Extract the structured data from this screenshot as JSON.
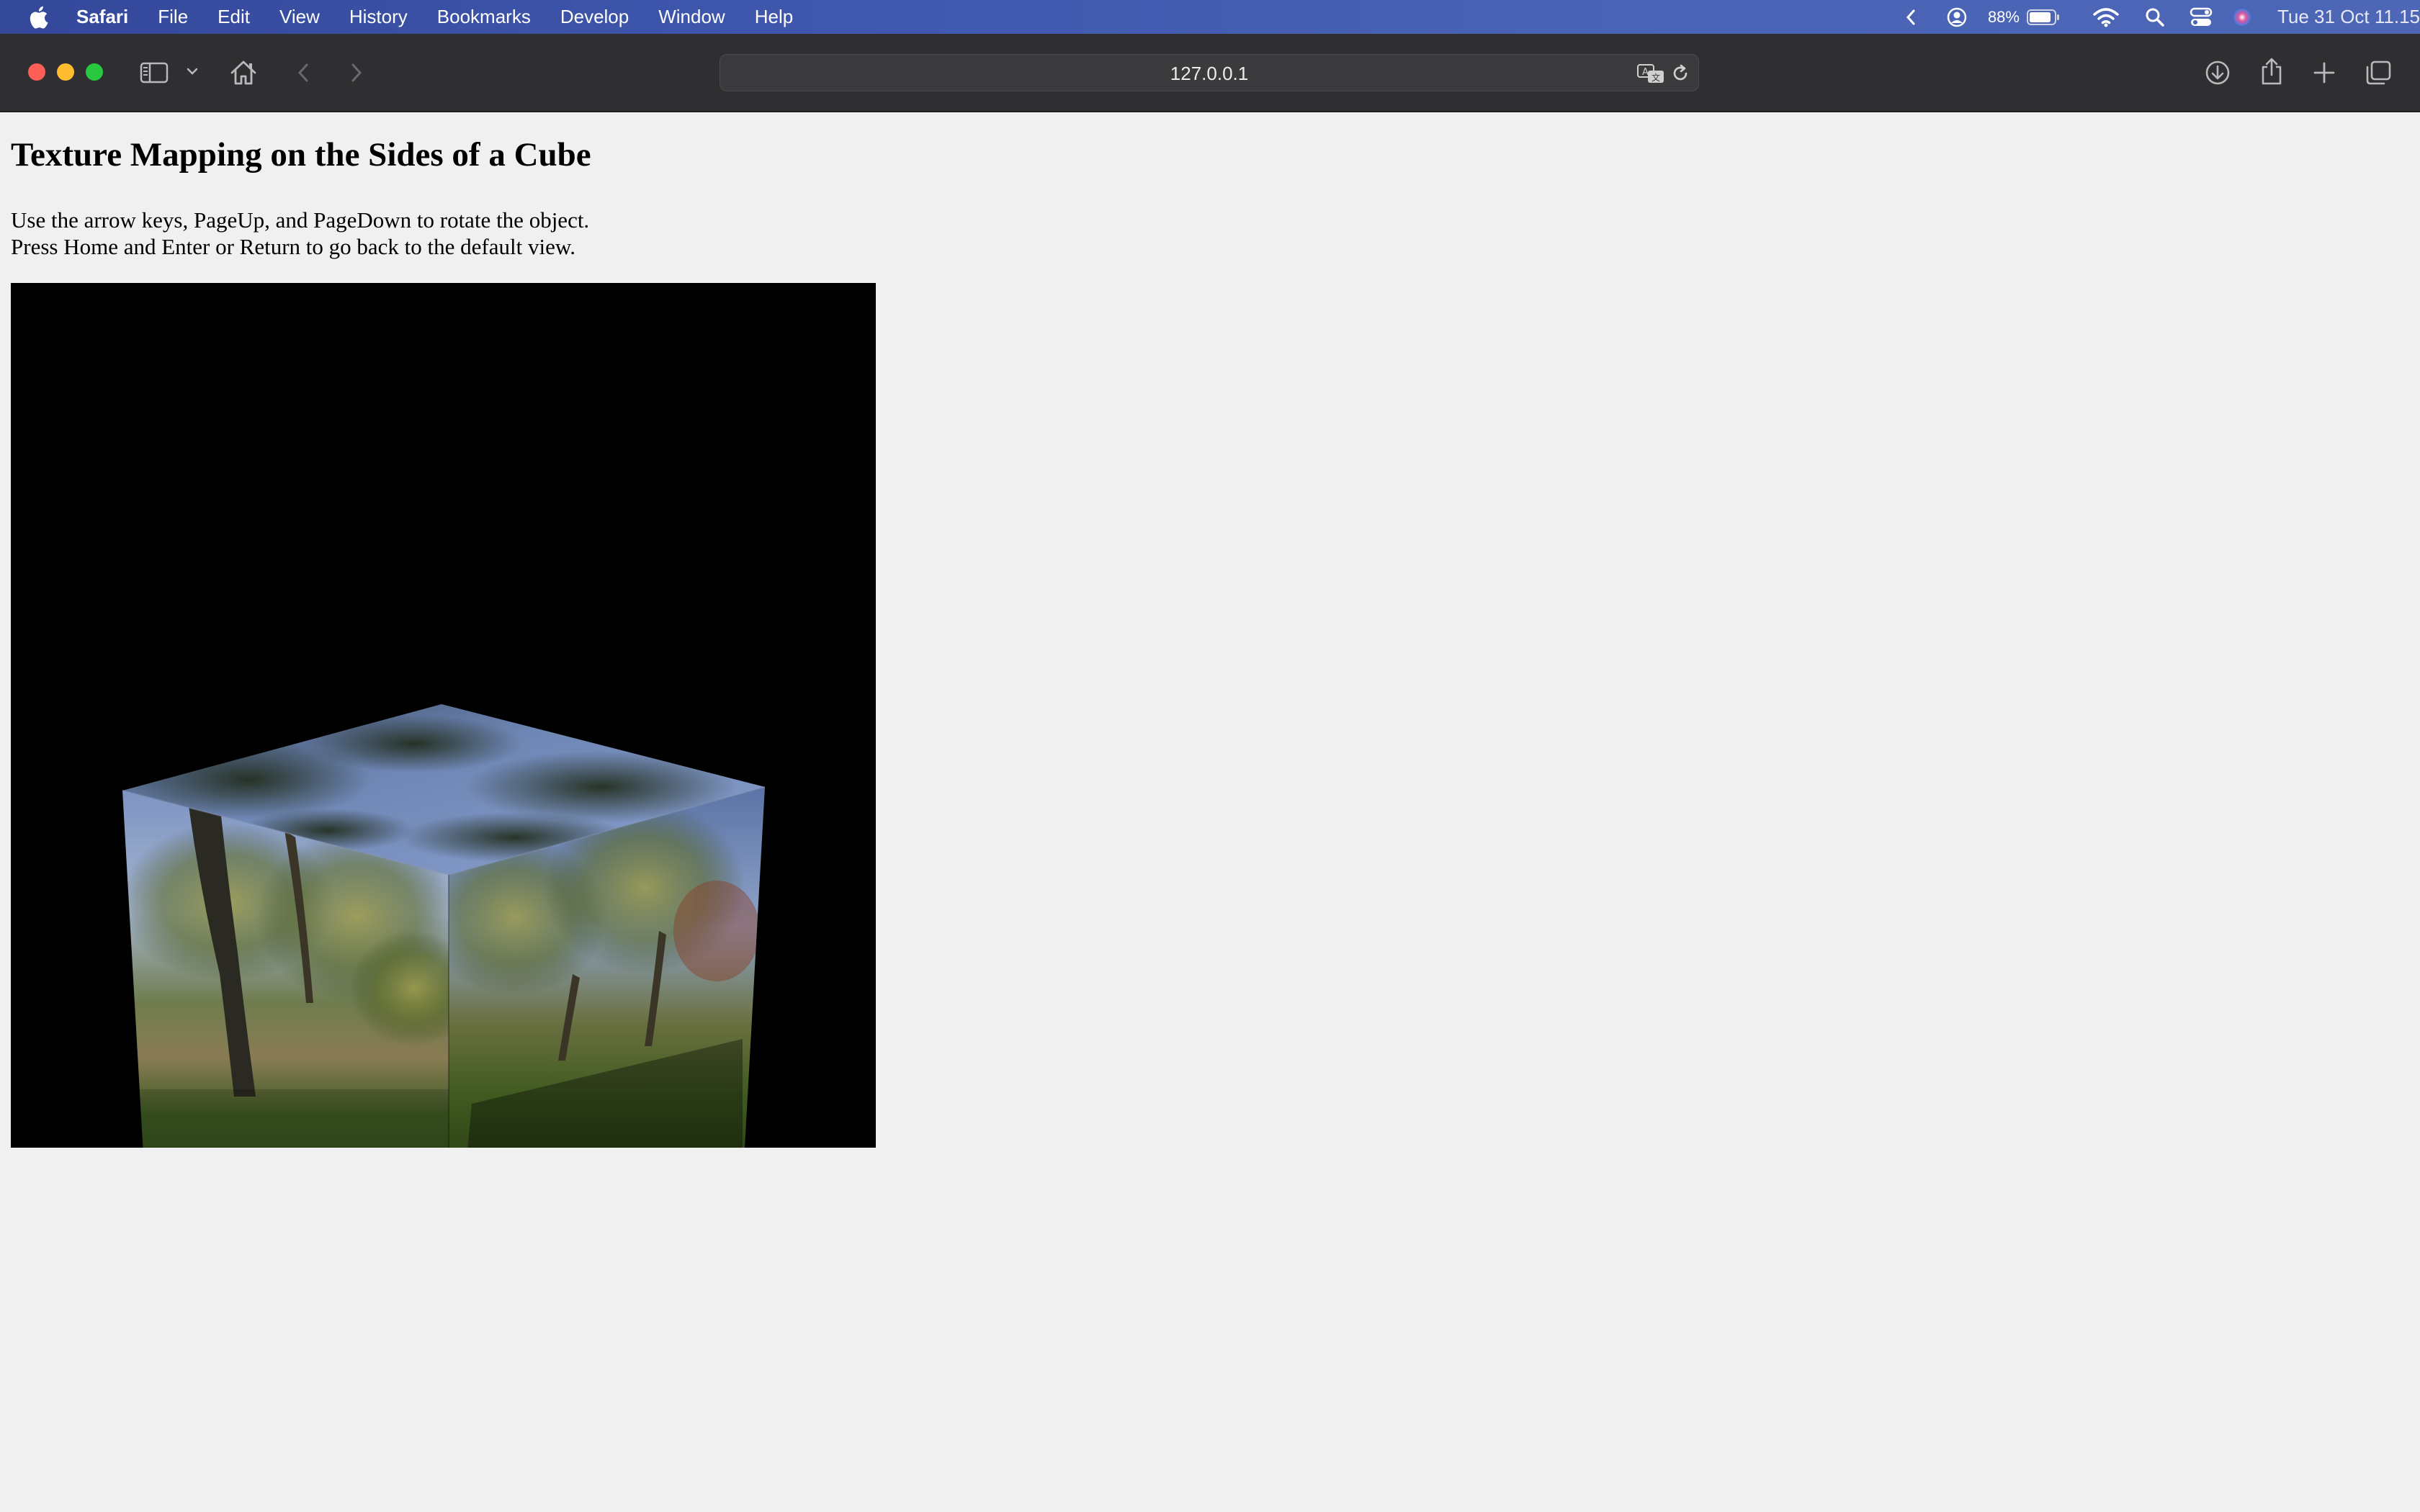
{
  "menubar": {
    "app_name": "Safari",
    "items": [
      "File",
      "Edit",
      "View",
      "History",
      "Bookmarks",
      "Develop",
      "Window",
      "Help"
    ],
    "battery_percent": "88%",
    "clock": "Tue 31 Oct  11.15"
  },
  "browser": {
    "url": "127.0.0.1"
  },
  "page": {
    "title": "Texture Mapping on the Sides of a Cube",
    "instruction_line1": "Use the arrow keys, PageUp, and PageDown to rotate the object.",
    "instruction_line2": "Press Home and Enter or Return to go back to the default view."
  },
  "colors": {
    "menubar_accent": "#4a64b6",
    "toolbar_bg": "#2f2f31",
    "page_bg": "#f0f0f0",
    "canvas_bg": "#000000"
  }
}
